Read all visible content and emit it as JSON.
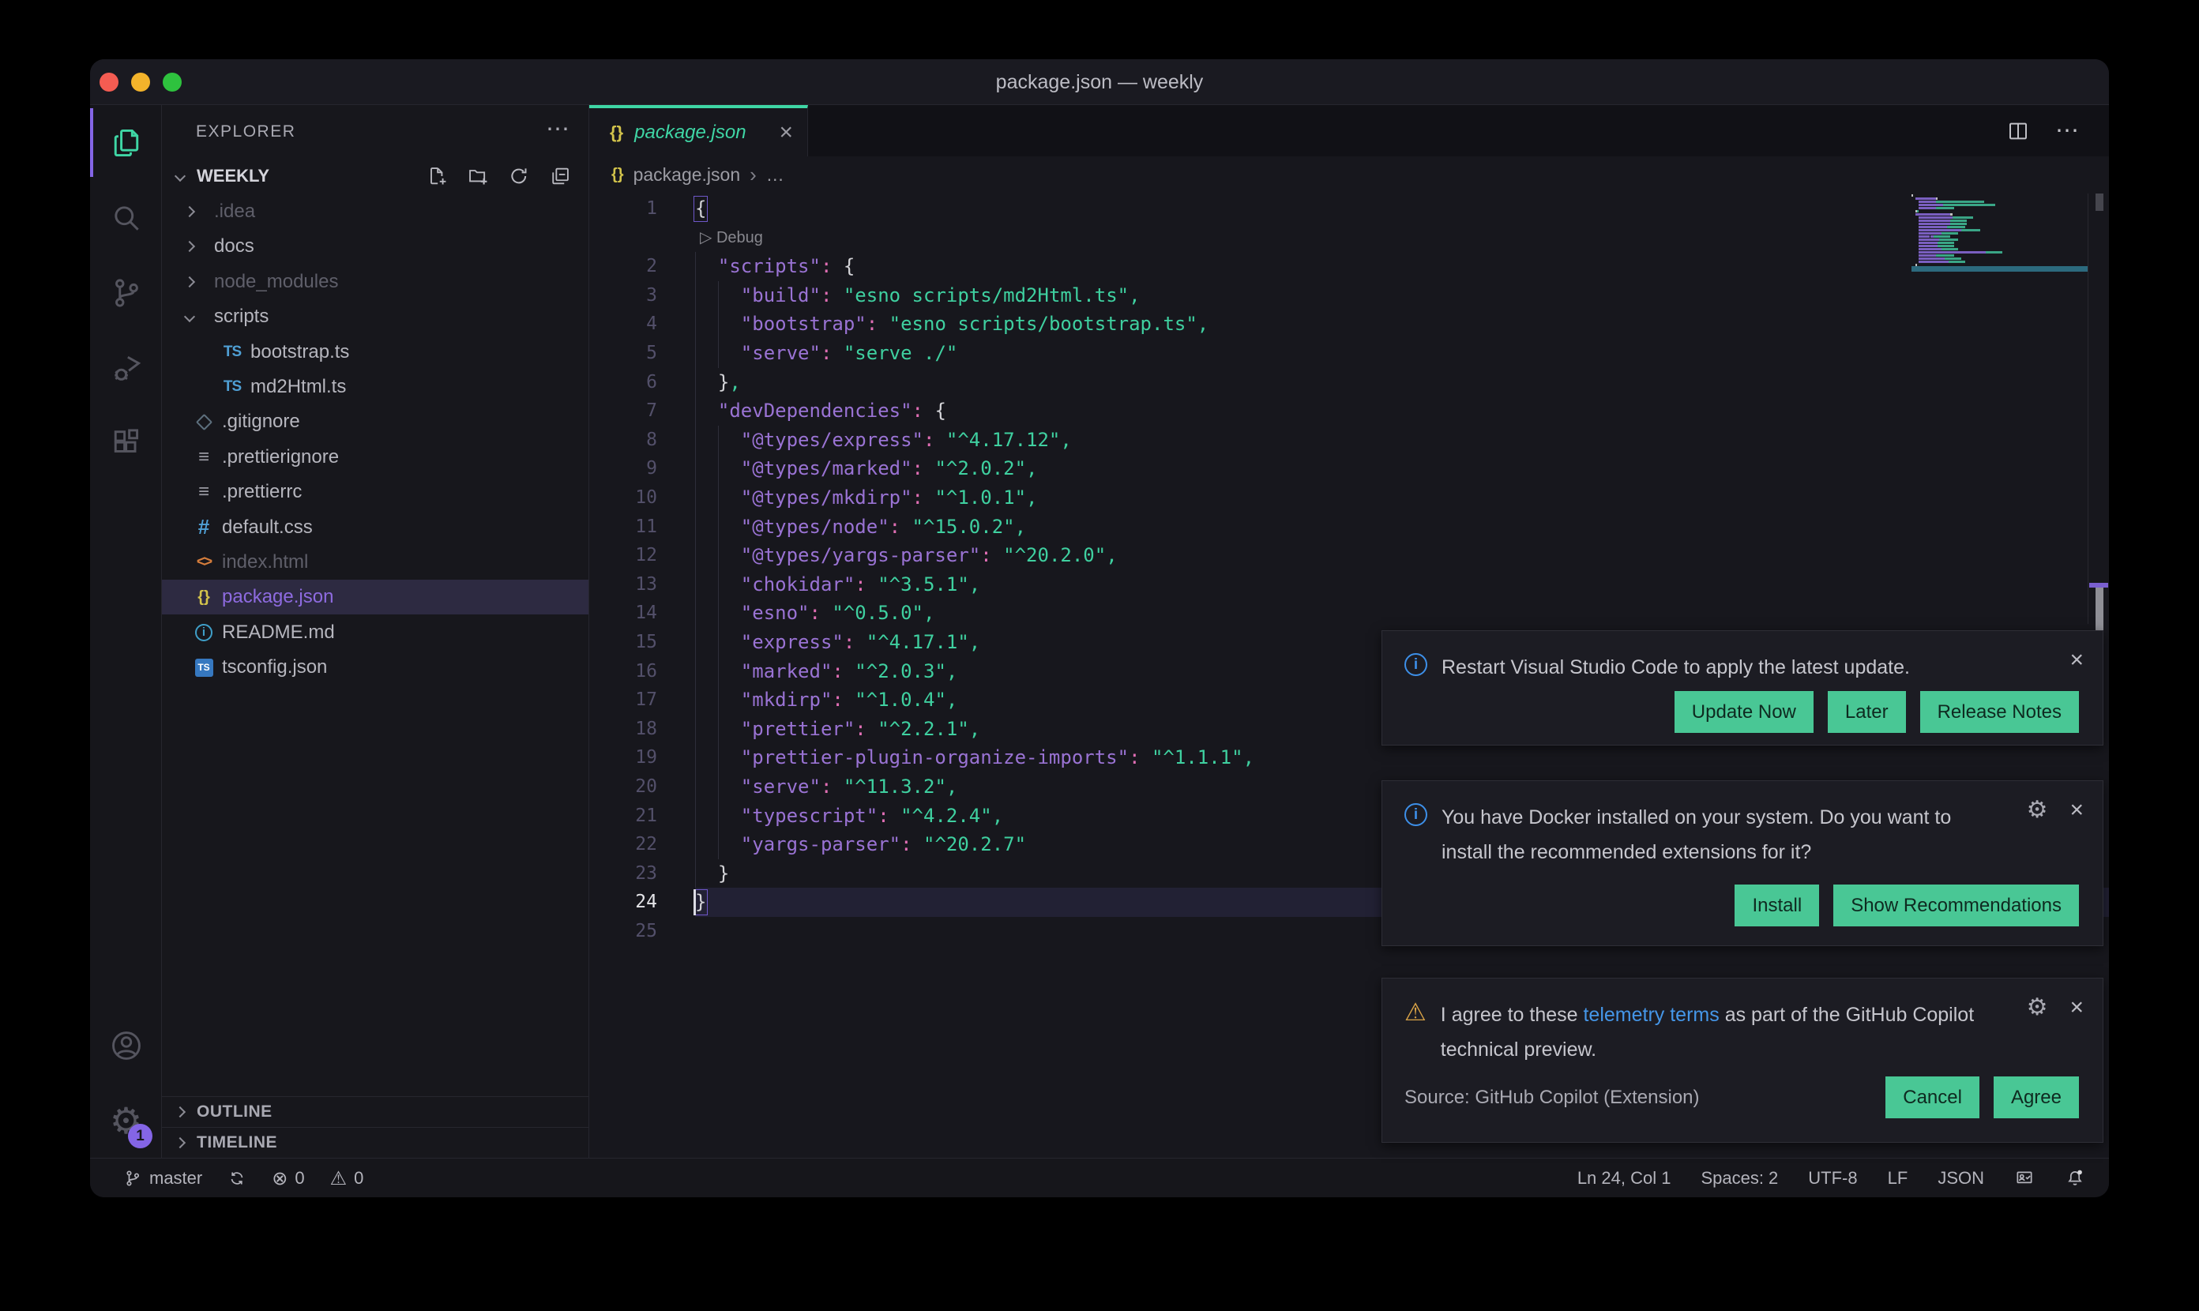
{
  "window": {
    "title": "package.json — weekly",
    "traffic_lights": [
      "#f45c52",
      "#f3b32b",
      "#2ec23e"
    ]
  },
  "colors": {
    "accent_teal": "#3fd6a5",
    "accent_purple": "#8465e6",
    "button_bg": "#49c795",
    "info_icon": "#3d8fe8",
    "warning_icon": "#d8a247",
    "link": "#4596e8"
  },
  "activity_bar": {
    "items": [
      {
        "name": "explorer",
        "active": true
      },
      {
        "name": "search",
        "active": false
      },
      {
        "name": "source-control",
        "active": false
      },
      {
        "name": "run-debug",
        "active": false
      },
      {
        "name": "extensions",
        "active": false
      }
    ],
    "bottom": [
      {
        "name": "account"
      },
      {
        "name": "settings",
        "badge": "1"
      }
    ]
  },
  "sidebar": {
    "title": "EXPLORER",
    "more_label": "⋯",
    "section": "WEEKLY",
    "section_actions": [
      "new-file",
      "new-folder",
      "refresh",
      "collapse-all"
    ],
    "tree": [
      {
        "label": ".idea",
        "type": "folder",
        "dimmed": true
      },
      {
        "label": "docs",
        "type": "folder",
        "dimmed": false
      },
      {
        "label": "node_modules",
        "type": "folder",
        "dimmed": true
      },
      {
        "label": "scripts",
        "type": "folder",
        "expanded": true
      },
      {
        "label": "bootstrap.ts",
        "type": "ts",
        "child": true
      },
      {
        "label": "md2Html.ts",
        "type": "ts",
        "child": true
      },
      {
        "label": ".gitignore",
        "type": "git"
      },
      {
        "label": ".prettierignore",
        "type": "prettier"
      },
      {
        "label": ".prettierrc",
        "type": "prettier"
      },
      {
        "label": "default.css",
        "type": "css"
      },
      {
        "label": "index.html",
        "type": "html",
        "dimmed": true
      },
      {
        "label": "package.json",
        "type": "json",
        "selected": true
      },
      {
        "label": "README.md",
        "type": "md"
      },
      {
        "label": "tsconfig.json",
        "type": "tsconfig"
      }
    ],
    "panels": [
      "OUTLINE",
      "TIMELINE"
    ]
  },
  "editor": {
    "tab": {
      "icon": "{}",
      "label": "package.json",
      "close": "×"
    },
    "actions": [
      "split-editor",
      "more"
    ],
    "more_label": "⋯",
    "breadcrumb": {
      "icon": "{}",
      "file": "package.json",
      "separator": "›",
      "rest": "…"
    },
    "codelens": {
      "icon": "▷",
      "label": "Debug",
      "before_line": 2
    },
    "cursor": {
      "line": 24,
      "col": 1
    },
    "lines": [
      {
        "n": 1,
        "i": 0,
        "t": [
          [
            "b",
            "{"
          ]
        ],
        "match": true
      },
      {
        "n": 2,
        "i": 1,
        "t": [
          [
            "k",
            "\"scripts\""
          ],
          [
            "c",
            ": "
          ],
          [
            "b",
            "{"
          ]
        ]
      },
      {
        "n": 3,
        "i": 2,
        "t": [
          [
            "k",
            "\"build\""
          ],
          [
            "c",
            ": "
          ],
          [
            "s",
            "\"esno scripts/md2Html.ts\""
          ],
          [
            "m",
            ","
          ]
        ]
      },
      {
        "n": 4,
        "i": 2,
        "t": [
          [
            "k",
            "\"bootstrap\""
          ],
          [
            "c",
            ": "
          ],
          [
            "s",
            "\"esno scripts/bootstrap.ts\""
          ],
          [
            "m",
            ","
          ]
        ]
      },
      {
        "n": 5,
        "i": 2,
        "t": [
          [
            "k",
            "\"serve\""
          ],
          [
            "c",
            ": "
          ],
          [
            "s",
            "\"serve ./\""
          ]
        ]
      },
      {
        "n": 6,
        "i": 1,
        "t": [
          [
            "b",
            "}"
          ],
          [
            "m",
            ","
          ]
        ]
      },
      {
        "n": 7,
        "i": 1,
        "t": [
          [
            "k",
            "\"devDependencies\""
          ],
          [
            "c",
            ": "
          ],
          [
            "b",
            "{"
          ]
        ]
      },
      {
        "n": 8,
        "i": 2,
        "t": [
          [
            "k",
            "\"@types/express\""
          ],
          [
            "c",
            ": "
          ],
          [
            "s",
            "\"^4.17.12\""
          ],
          [
            "m",
            ","
          ]
        ]
      },
      {
        "n": 9,
        "i": 2,
        "t": [
          [
            "k",
            "\"@types/marked\""
          ],
          [
            "c",
            ": "
          ],
          [
            "s",
            "\"^2.0.2\""
          ],
          [
            "m",
            ","
          ]
        ]
      },
      {
        "n": 10,
        "i": 2,
        "t": [
          [
            "k",
            "\"@types/mkdirp\""
          ],
          [
            "c",
            ": "
          ],
          [
            "s",
            "\"^1.0.1\""
          ],
          [
            "m",
            ","
          ]
        ]
      },
      {
        "n": 11,
        "i": 2,
        "t": [
          [
            "k",
            "\"@types/node\""
          ],
          [
            "c",
            ": "
          ],
          [
            "s",
            "\"^15.0.2\""
          ],
          [
            "m",
            ","
          ]
        ]
      },
      {
        "n": 12,
        "i": 2,
        "t": [
          [
            "k",
            "\"@types/yargs-parser\""
          ],
          [
            "c",
            ": "
          ],
          [
            "s",
            "\"^20.2.0\""
          ],
          [
            "m",
            ","
          ]
        ]
      },
      {
        "n": 13,
        "i": 2,
        "t": [
          [
            "k",
            "\"chokidar\""
          ],
          [
            "c",
            ": "
          ],
          [
            "s",
            "\"^3.5.1\""
          ],
          [
            "m",
            ","
          ]
        ]
      },
      {
        "n": 14,
        "i": 2,
        "t": [
          [
            "k",
            "\"esno\""
          ],
          [
            "c",
            ": "
          ],
          [
            "s",
            "\"^0.5.0\""
          ],
          [
            "m",
            ","
          ]
        ]
      },
      {
        "n": 15,
        "i": 2,
        "t": [
          [
            "k",
            "\"express\""
          ],
          [
            "c",
            ": "
          ],
          [
            "s",
            "\"^4.17.1\""
          ],
          [
            "m",
            ","
          ]
        ]
      },
      {
        "n": 16,
        "i": 2,
        "t": [
          [
            "k",
            "\"marked\""
          ],
          [
            "c",
            ": "
          ],
          [
            "s",
            "\"^2.0.3\""
          ],
          [
            "m",
            ","
          ]
        ]
      },
      {
        "n": 17,
        "i": 2,
        "t": [
          [
            "k",
            "\"mkdirp\""
          ],
          [
            "c",
            ": "
          ],
          [
            "s",
            "\"^1.0.4\""
          ],
          [
            "m",
            ","
          ]
        ]
      },
      {
        "n": 18,
        "i": 2,
        "t": [
          [
            "k",
            "\"prettier\""
          ],
          [
            "c",
            ": "
          ],
          [
            "s",
            "\"^2.2.1\""
          ],
          [
            "m",
            ","
          ]
        ]
      },
      {
        "n": 19,
        "i": 2,
        "t": [
          [
            "k",
            "\"prettier-plugin-organize-imports\""
          ],
          [
            "c",
            ": "
          ],
          [
            "s",
            "\"^1.1.1\""
          ],
          [
            "m",
            ","
          ]
        ]
      },
      {
        "n": 20,
        "i": 2,
        "t": [
          [
            "k",
            "\"serve\""
          ],
          [
            "c",
            ": "
          ],
          [
            "s",
            "\"^11.3.2\""
          ],
          [
            "m",
            ","
          ]
        ]
      },
      {
        "n": 21,
        "i": 2,
        "t": [
          [
            "k",
            "\"typescript\""
          ],
          [
            "c",
            ": "
          ],
          [
            "s",
            "\"^4.2.4\""
          ],
          [
            "m",
            ","
          ]
        ]
      },
      {
        "n": 22,
        "i": 2,
        "t": [
          [
            "k",
            "\"yargs-parser\""
          ],
          [
            "c",
            ": "
          ],
          [
            "s",
            "\"^20.2.7\""
          ]
        ]
      },
      {
        "n": 23,
        "i": 1,
        "t": [
          [
            "b",
            "}"
          ]
        ]
      },
      {
        "n": 24,
        "i": 0,
        "t": [
          [
            "b",
            "}"
          ]
        ],
        "match": true,
        "current": true,
        "cursor": true
      },
      {
        "n": 25,
        "i": 0,
        "t": []
      }
    ]
  },
  "notifications": [
    {
      "icon": "info",
      "parts": [
        {
          "text": "Restart Visual Studio Code to apply the latest update."
        }
      ],
      "gear": false,
      "close": "×",
      "source": null,
      "actions": [
        "Update Now",
        "Later",
        "Release Notes"
      ]
    },
    {
      "icon": "info",
      "parts": [
        {
          "text": "You have Docker installed on your system. Do you want to install the recommended extensions for it?"
        }
      ],
      "gear": true,
      "close": "×",
      "source": null,
      "actions": [
        "Install",
        "Show Recommendations"
      ]
    },
    {
      "icon": "warning",
      "parts": [
        {
          "text": "I agree to these "
        },
        {
          "text": "telemetry terms",
          "link": true
        },
        {
          "text": " as part of the GitHub Copilot technical preview."
        }
      ],
      "gear": true,
      "close": "×",
      "source": "Source: GitHub Copilot (Extension)",
      "actions": [
        "Cancel",
        "Agree"
      ]
    }
  ],
  "status_bar": {
    "left": [
      {
        "icon": "git-branch",
        "label": "master"
      },
      {
        "icon": "sync",
        "label": ""
      },
      {
        "icon": "errors",
        "label": "0"
      },
      {
        "icon": "warnings",
        "label": "0"
      }
    ],
    "right": [
      {
        "label": "Ln 24, Col 1"
      },
      {
        "label": "Spaces: 2"
      },
      {
        "label": "UTF-8"
      },
      {
        "label": "LF"
      },
      {
        "label": "JSON"
      },
      {
        "icon": "feedback",
        "label": ""
      },
      {
        "icon": "bell",
        "label": ""
      }
    ]
  }
}
